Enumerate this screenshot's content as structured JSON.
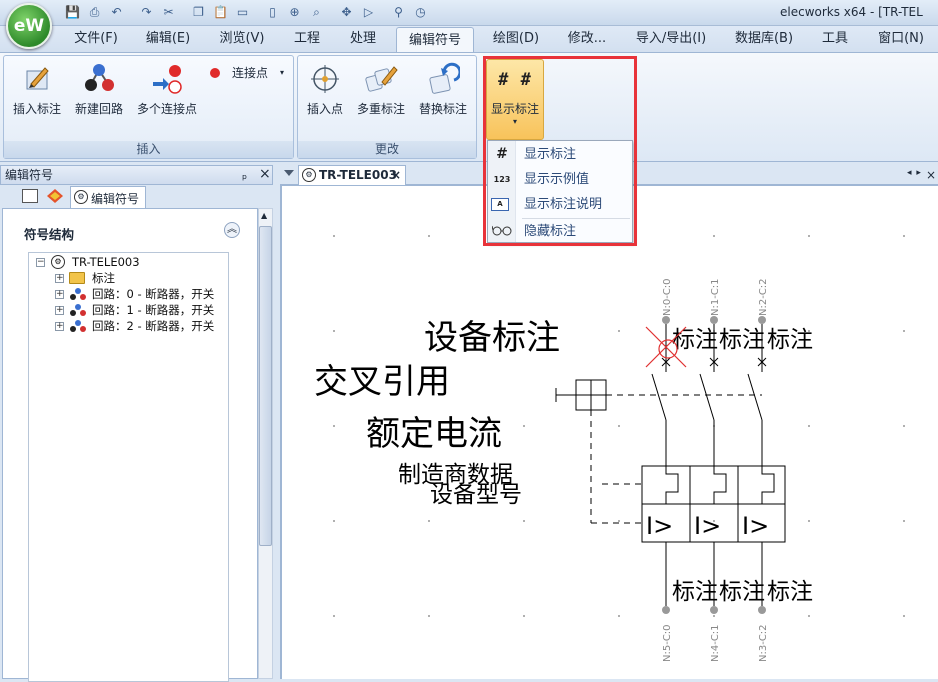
{
  "app": {
    "logo_text": "eW",
    "title": "elecworks x64 - [TR-TEL",
    "accent": "#f8c35b",
    "highlight_color": "#e8333a"
  },
  "quick_access": [
    "save-icon",
    "print-icon",
    "undo-icon",
    "redo-icon",
    "cut-icon",
    "copy-icon",
    "paste-icon",
    "page-icon",
    "page2-icon",
    "zoom-fit-icon",
    "zoom-icon",
    "pan-icon",
    "run-icon",
    "binoculars-icon",
    "clock-icon"
  ],
  "menu": {
    "tabs": [
      "文件(F)",
      "编辑(E)",
      "浏览(V)",
      "工程",
      "处理",
      "编辑符号",
      "绘图(D)",
      "修改...",
      "导入/导出(I)",
      "数据库(B)",
      "工具",
      "窗口(N)"
    ],
    "active": "编辑符号"
  },
  "ribbon": {
    "insert_group": {
      "label": "插入",
      "buttons": [
        "插入标注",
        "新建回路",
        "多个连接点"
      ],
      "connection_point": "连接点"
    },
    "modify_group": {
      "label": "更改",
      "buttons": [
        "插入点",
        "多重标注",
        "替换标注"
      ]
    },
    "show_button": {
      "label": "显示标注",
      "icon_text": "# #"
    }
  },
  "dropdown": {
    "items": [
      {
        "icon": "#",
        "label": "显示标注"
      },
      {
        "icon": "123",
        "label": "显示示例值"
      },
      {
        "icon": "A",
        "label": "显示标注说明"
      },
      {
        "icon": "glasses",
        "label": "隐藏标注"
      }
    ]
  },
  "left_panel": {
    "title": "编辑符号",
    "pin_glyph": "ₚ",
    "close_glyph": "×",
    "tab_label": "编辑符号",
    "section_title": "符号结构",
    "tree": {
      "root": "TR-TELE003",
      "children": [
        "标注",
        "回路：0 - 断路器，开关",
        "回路：1 - 断路器，开关",
        "回路：2 - 断路器，开关"
      ]
    }
  },
  "document": {
    "tab_label": "TR-TELE003",
    "drawing": {
      "labels": [
        "设备标注",
        "交叉引用",
        "额定电流",
        "制造商数据",
        "设备型号"
      ],
      "top_marks": [
        "标注",
        "标注",
        "标注"
      ],
      "bottom_marks": [
        "标注",
        "标注",
        "标注"
      ],
      "top_terminals": [
        "N:0-C:0",
        "N:1-C:1",
        "N:2-C:2"
      ],
      "bottom_terminals": [
        "N:5-C:0",
        "N:4-C:1",
        "N:3-C:2"
      ],
      "trip_symbol": "I>"
    }
  }
}
